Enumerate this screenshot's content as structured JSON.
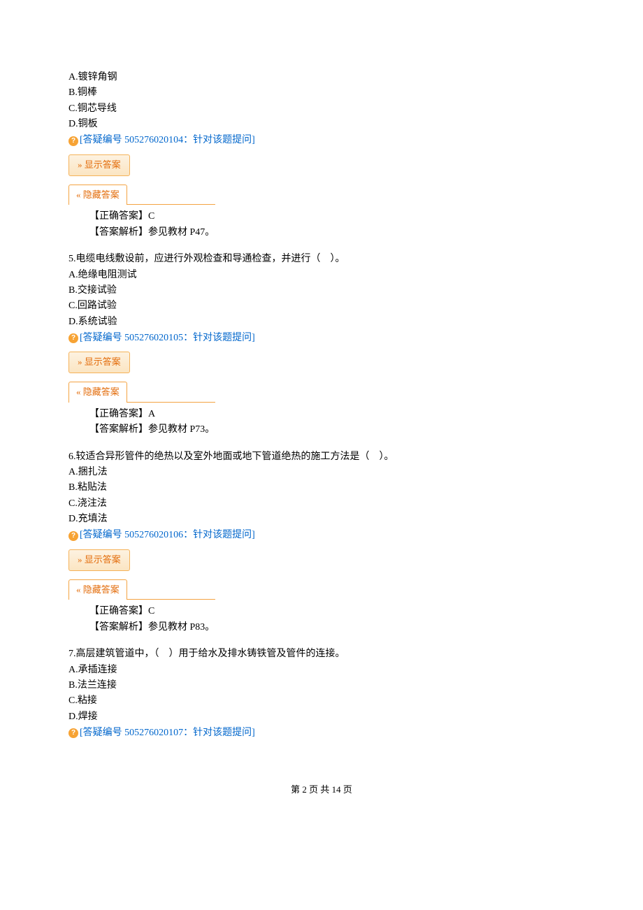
{
  "q4": {
    "optA": "A.镀锌角钢",
    "optB": "B.铜棒",
    "optC": "C.铜芯导线",
    "optD": "D.铜板",
    "link": "[答疑编号 505276020104：针对该题提问]",
    "showBtn": "»  显示答案",
    "hideBtn": "«  隐藏答案",
    "ansLabel": "【正确答案】C",
    "analysis": "【答案解析】参见教材 P47。"
  },
  "q5": {
    "question": "5.电缆电线敷设前，应进行外观检查和导通检查，并进行（　）。",
    "optA": "A.绝缘电阻测试",
    "optB": "B.交接试验",
    "optC": "C.回路试验",
    "optD": "D.系统试验",
    "link": "[答疑编号 505276020105：针对该题提问]",
    "showBtn": "»  显示答案",
    "hideBtn": "«  隐藏答案",
    "ansLabel": "【正确答案】A",
    "analysis": "【答案解析】参见教材 P73。"
  },
  "q6": {
    "question": "6.较适合异形管件的绝热以及室外地面或地下管道绝热的施工方法是（　）。",
    "optA": "A.捆扎法",
    "optB": "B.粘贴法",
    "optC": "C.浇注法",
    "optD": "D.充填法",
    "link": "[答疑编号 505276020106：针对该题提问]",
    "showBtn": "»  显示答案",
    "hideBtn": "«  隐藏答案",
    "ansLabel": "【正确答案】C",
    "analysis": "【答案解析】参见教材 P83。"
  },
  "q7": {
    "question": "7.高层建筑管道中，（　）用于给水及排水铸铁管及管件的连接。",
    "optA": "A.承插连接",
    "optB": "B.法兰连接",
    "optC": "C.粘接",
    "optD": "D.焊接",
    "link": "[答疑编号 505276020107：针对该题提问]"
  },
  "footer": {
    "page": "第 2 页 共 14 页"
  }
}
